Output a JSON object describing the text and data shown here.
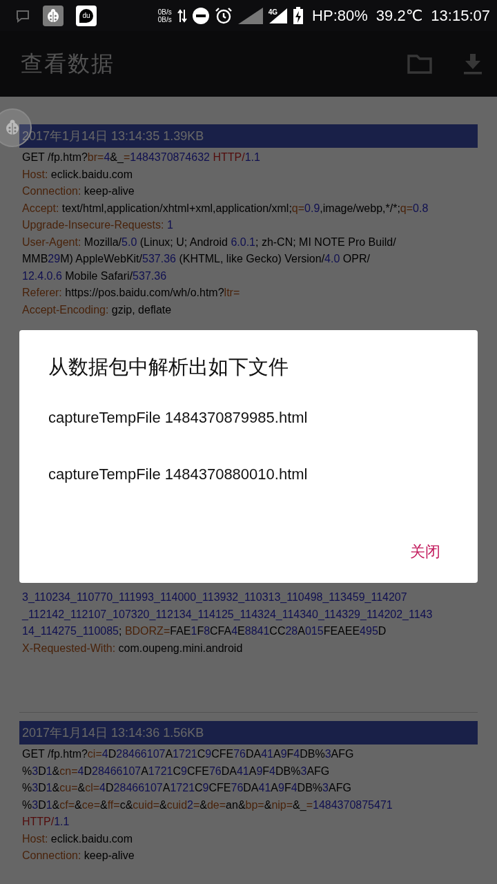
{
  "status_bar": {
    "net_speed_up": "0B/s",
    "net_speed_down": "0B/s",
    "network_type": "4G",
    "battery": "HP:80%",
    "temperature": "39.2℃",
    "time": "13:15:07",
    "app_icon_text": "du"
  },
  "app_bar": {
    "title": "查看数据"
  },
  "packets": [
    {
      "header": "2017年1月14日 13:14:35 1.39KB",
      "lines": [
        [
          {
            "kind": "plain",
            "text": "GET /fp.htm?"
          },
          {
            "kind": "key",
            "text": "br="
          },
          {
            "kind": "num",
            "text": "4"
          },
          {
            "kind": "plain",
            "text": "&_"
          },
          {
            "kind": "key",
            "text": "="
          },
          {
            "kind": "num",
            "text": "1484370874632"
          },
          {
            "kind": "proto",
            "text": " HTTP/"
          },
          {
            "kind": "num",
            "text": "1.1"
          }
        ],
        [
          {
            "kind": "key",
            "text": "Host:"
          },
          {
            "kind": "plain",
            "text": " eclick.baidu.com"
          }
        ],
        [
          {
            "kind": "key",
            "text": "Connection:"
          },
          {
            "kind": "plain",
            "text": " keep-alive"
          }
        ],
        [
          {
            "kind": "key",
            "text": "Accept:"
          },
          {
            "kind": "plain",
            "text": " text/html,application/xhtml+xml,application/xml;"
          },
          {
            "kind": "key",
            "text": "q="
          },
          {
            "kind": "num",
            "text": "0.9"
          },
          {
            "kind": "plain",
            "text": ",image/webp,*/*;"
          },
          {
            "kind": "key",
            "text": "q="
          },
          {
            "kind": "num",
            "text": "0.8"
          }
        ],
        [
          {
            "kind": "key",
            "text": "Upgrade-Insecure-Requests: "
          },
          {
            "kind": "num",
            "text": "1"
          }
        ],
        [
          {
            "kind": "key",
            "text": "User-Agent:"
          },
          {
            "kind": "plain",
            "text": " Mozilla/"
          },
          {
            "kind": "num",
            "text": "5.0"
          },
          {
            "kind": "plain",
            "text": " (Linux; U; Android "
          },
          {
            "kind": "num",
            "text": "6.0.1"
          },
          {
            "kind": "plain",
            "text": "; zh-CN; MI NOTE Pro Build/"
          }
        ],
        [
          {
            "kind": "plain",
            "text": "MMB"
          },
          {
            "kind": "num",
            "text": "29"
          },
          {
            "kind": "plain",
            "text": "M) AppleWebKit/"
          },
          {
            "kind": "num",
            "text": "537.36"
          },
          {
            "kind": "plain",
            "text": " (KHTML, like Gecko) Version/"
          },
          {
            "kind": "num",
            "text": "4.0"
          },
          {
            "kind": "plain",
            "text": " OPR/"
          }
        ],
        [
          {
            "kind": "num",
            "text": "12.4.0.6"
          },
          {
            "kind": "plain",
            "text": " Mobile Safari/"
          },
          {
            "kind": "num",
            "text": "537.36"
          }
        ],
        [
          {
            "kind": "key",
            "text": "Referer:"
          },
          {
            "kind": "plain",
            "text": " https://pos.baidu.com/wh/o.htm?"
          },
          {
            "kind": "key",
            "text": "ltr="
          }
        ],
        [
          {
            "kind": "key",
            "text": "Accept-Encoding:"
          },
          {
            "kind": "plain",
            "text": " gzip, deflate"
          }
        ],
        [
          {
            "kind": "num",
            "text": "3_110234_110770_111993_114000_113932_110313_110498_113459_114207"
          }
        ],
        [
          {
            "kind": "num",
            "text": "_112142_112107_107320_112134_114125_114324_114340_114329_114202_1143"
          }
        ],
        [
          {
            "kind": "num",
            "text": "14_114275_110085"
          },
          {
            "kind": "plain",
            "text": "; "
          },
          {
            "kind": "key",
            "text": "BDORZ="
          },
          {
            "kind": "plain",
            "text": "FAE"
          },
          {
            "kind": "num",
            "text": "1"
          },
          {
            "kind": "plain",
            "text": "F"
          },
          {
            "kind": "num",
            "text": "8"
          },
          {
            "kind": "plain",
            "text": "CFA"
          },
          {
            "kind": "num",
            "text": "4"
          },
          {
            "kind": "plain",
            "text": "E"
          },
          {
            "kind": "num",
            "text": "8841"
          },
          {
            "kind": "plain",
            "text": "CC"
          },
          {
            "kind": "num",
            "text": "28"
          },
          {
            "kind": "plain",
            "text": "A"
          },
          {
            "kind": "num",
            "text": "015"
          },
          {
            "kind": "plain",
            "text": "FEAEE"
          },
          {
            "kind": "num",
            "text": "495"
          },
          {
            "kind": "plain",
            "text": "D"
          }
        ],
        [
          {
            "kind": "key",
            "text": "X-Requested-With:"
          },
          {
            "kind": "plain",
            "text": " com.oupeng.mini.android"
          }
        ]
      ]
    },
    {
      "header": "2017年1月14日 13:14:36 1.56KB",
      "lines": [
        [
          {
            "kind": "plain",
            "text": "GET /fp.htm?"
          },
          {
            "kind": "key",
            "text": "ci="
          },
          {
            "kind": "num",
            "text": "4"
          },
          {
            "kind": "plain",
            "text": "D"
          },
          {
            "kind": "num",
            "text": "28466107"
          },
          {
            "kind": "plain",
            "text": "A"
          },
          {
            "kind": "num",
            "text": "1721"
          },
          {
            "kind": "plain",
            "text": "C"
          },
          {
            "kind": "num",
            "text": "9"
          },
          {
            "kind": "plain",
            "text": "CFE"
          },
          {
            "kind": "num",
            "text": "76"
          },
          {
            "kind": "plain",
            "text": "DA"
          },
          {
            "kind": "num",
            "text": "41"
          },
          {
            "kind": "plain",
            "text": "A"
          },
          {
            "kind": "num",
            "text": "9"
          },
          {
            "kind": "plain",
            "text": "F"
          },
          {
            "kind": "num",
            "text": "4"
          },
          {
            "kind": "plain",
            "text": "DB%"
          },
          {
            "kind": "num",
            "text": "3"
          },
          {
            "kind": "plain",
            "text": "AFG"
          }
        ],
        [
          {
            "kind": "plain",
            "text": "%"
          },
          {
            "kind": "num",
            "text": "3"
          },
          {
            "kind": "plain",
            "text": "D"
          },
          {
            "kind": "num",
            "text": "1"
          },
          {
            "kind": "plain",
            "text": "&"
          },
          {
            "kind": "key",
            "text": "cn="
          },
          {
            "kind": "num",
            "text": "4"
          },
          {
            "kind": "plain",
            "text": "D"
          },
          {
            "kind": "num",
            "text": "28466107"
          },
          {
            "kind": "plain",
            "text": "A"
          },
          {
            "kind": "num",
            "text": "1721"
          },
          {
            "kind": "plain",
            "text": "C"
          },
          {
            "kind": "num",
            "text": "9"
          },
          {
            "kind": "plain",
            "text": "CFE"
          },
          {
            "kind": "num",
            "text": "76"
          },
          {
            "kind": "plain",
            "text": "DA"
          },
          {
            "kind": "num",
            "text": "41"
          },
          {
            "kind": "plain",
            "text": "A"
          },
          {
            "kind": "num",
            "text": "9"
          },
          {
            "kind": "plain",
            "text": "F"
          },
          {
            "kind": "num",
            "text": "4"
          },
          {
            "kind": "plain",
            "text": "DB%"
          },
          {
            "kind": "num",
            "text": "3"
          },
          {
            "kind": "plain",
            "text": "AFG"
          }
        ],
        [
          {
            "kind": "plain",
            "text": "%"
          },
          {
            "kind": "num",
            "text": "3"
          },
          {
            "kind": "plain",
            "text": "D"
          },
          {
            "kind": "num",
            "text": "1"
          },
          {
            "kind": "plain",
            "text": "&"
          },
          {
            "kind": "key",
            "text": "cu="
          },
          {
            "kind": "plain",
            "text": "&"
          },
          {
            "kind": "key",
            "text": "cl="
          },
          {
            "kind": "num",
            "text": "4"
          },
          {
            "kind": "plain",
            "text": "D"
          },
          {
            "kind": "num",
            "text": "28466107"
          },
          {
            "kind": "plain",
            "text": "A"
          },
          {
            "kind": "num",
            "text": "1721"
          },
          {
            "kind": "plain",
            "text": "C"
          },
          {
            "kind": "num",
            "text": "9"
          },
          {
            "kind": "plain",
            "text": "CFE"
          },
          {
            "kind": "num",
            "text": "76"
          },
          {
            "kind": "plain",
            "text": "DA"
          },
          {
            "kind": "num",
            "text": "41"
          },
          {
            "kind": "plain",
            "text": "A"
          },
          {
            "kind": "num",
            "text": "9"
          },
          {
            "kind": "plain",
            "text": "F"
          },
          {
            "kind": "num",
            "text": "4"
          },
          {
            "kind": "plain",
            "text": "DB%"
          },
          {
            "kind": "num",
            "text": "3"
          },
          {
            "kind": "plain",
            "text": "AFG"
          }
        ],
        [
          {
            "kind": "plain",
            "text": "%"
          },
          {
            "kind": "num",
            "text": "3"
          },
          {
            "kind": "plain",
            "text": "D"
          },
          {
            "kind": "num",
            "text": "1"
          },
          {
            "kind": "plain",
            "text": "&"
          },
          {
            "kind": "key",
            "text": "cf="
          },
          {
            "kind": "plain",
            "text": "&"
          },
          {
            "kind": "key",
            "text": "ce="
          },
          {
            "kind": "plain",
            "text": "&"
          },
          {
            "kind": "key",
            "text": "ff="
          },
          {
            "kind": "plain",
            "text": "c&"
          },
          {
            "kind": "key",
            "text": "cuid="
          },
          {
            "kind": "plain",
            "text": "&"
          },
          {
            "kind": "key",
            "text": "cuid"
          },
          {
            "kind": "num",
            "text": "2"
          },
          {
            "kind": "key",
            "text": "="
          },
          {
            "kind": "plain",
            "text": "&"
          },
          {
            "kind": "key",
            "text": "de="
          },
          {
            "kind": "plain",
            "text": "an&"
          },
          {
            "kind": "key",
            "text": "bp="
          },
          {
            "kind": "plain",
            "text": "&"
          },
          {
            "kind": "key",
            "text": "nip="
          },
          {
            "kind": "plain",
            "text": "&_"
          },
          {
            "kind": "key",
            "text": "="
          },
          {
            "kind": "num",
            "text": "1484370875471"
          }
        ],
        [
          {
            "kind": "proto",
            "text": "HTTP/"
          },
          {
            "kind": "num",
            "text": "1.1"
          }
        ],
        [
          {
            "kind": "key",
            "text": "Host:"
          },
          {
            "kind": "plain",
            "text": " eclick.baidu.com"
          }
        ],
        [
          {
            "kind": "key",
            "text": "Connection:"
          },
          {
            "kind": "plain",
            "text": " keep-alive"
          }
        ]
      ]
    }
  ],
  "dialog": {
    "title": "从数据包中解析出如下文件",
    "files": [
      "captureTempFile 1484370879985.html",
      "captureTempFile 1484370880010.html"
    ],
    "close_button": "关闭"
  }
}
